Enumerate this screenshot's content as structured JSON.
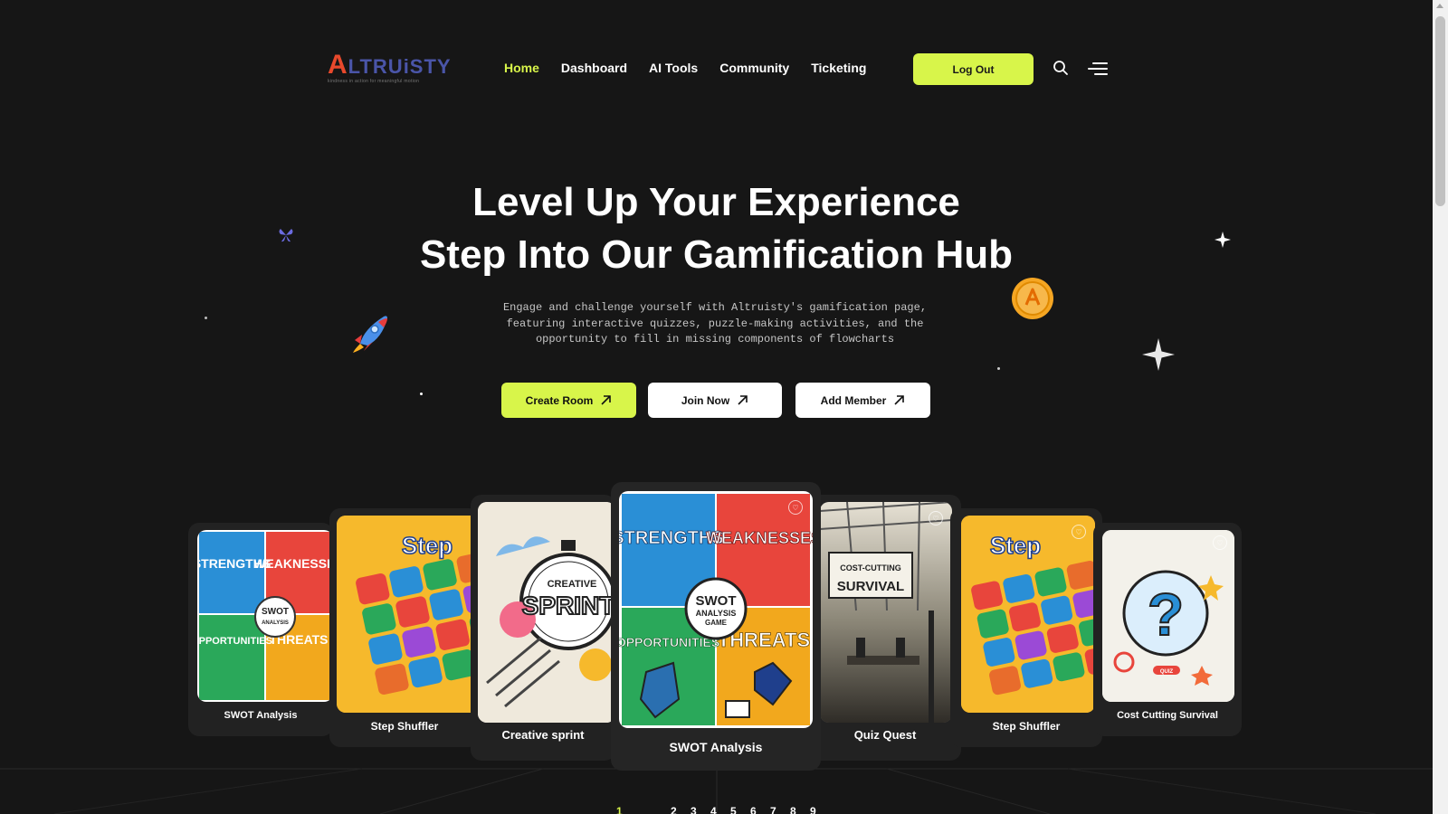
{
  "brand": {
    "name_first_letter": "A",
    "name_rest": "LTRUiSTY",
    "tagline": "kindness in action for meaningful motion"
  },
  "nav": {
    "items": [
      {
        "label": "Home",
        "active": true
      },
      {
        "label": "Dashboard",
        "active": false
      },
      {
        "label": "AI Tools",
        "active": false
      },
      {
        "label": "Community",
        "active": false
      },
      {
        "label": "Ticketing",
        "active": false
      }
    ],
    "logout_label": "Log Out",
    "search_icon": "search-icon",
    "menu_icon": "menu-icon"
  },
  "hero": {
    "title_line1": "Level Up Your Experience",
    "title_line2": "Step Into Our Gamification Hub",
    "description_line1": "Engage and challenge yourself with Altruisty's gamification page,",
    "description_line2": "featuring interactive quizzes, puzzle-making activities, and the",
    "description_line3": "opportunity to fill in missing components of flowcharts",
    "buttons": {
      "create_room": "Create Room",
      "join_now": "Join Now",
      "add_member": "Add Member"
    }
  },
  "carousel": {
    "cards": [
      {
        "title": "SWOT Analysis",
        "art": "swot"
      },
      {
        "title": "Step Shuffler",
        "art": "step"
      },
      {
        "title": "Creative sprint",
        "art": "sprint"
      },
      {
        "title": "SWOT Analysis",
        "art": "swot",
        "featured": true
      },
      {
        "title": "Quiz Quest",
        "art": "office"
      },
      {
        "title": "Step Shuffler",
        "art": "step"
      },
      {
        "title": "Cost Cutting Survival",
        "art": "quiz"
      }
    ],
    "art_labels": {
      "strengths": "STRENGTHS",
      "weaknesses": "WEAKNESSES",
      "opportunities": "OPPORTUNITIES",
      "threats": "THREATS",
      "swot_badge_1": "SWOT",
      "swot_badge_2": "ANALYSIS",
      "swot_badge_3": "GAME",
      "step": "Step",
      "creative": "CREATIVE",
      "sprint": "SPRINT",
      "cost_cutting": "COST-CUTTING",
      "survival": "SURVIVAL",
      "quiz": "QUIZ"
    }
  },
  "pagination": {
    "current": "1",
    "pages": [
      "2",
      "3",
      "4",
      "5",
      "6",
      "7",
      "8",
      "9"
    ]
  },
  "colors": {
    "background": "#161616",
    "accent": "#d8f54a",
    "card_bg": "#222222"
  }
}
